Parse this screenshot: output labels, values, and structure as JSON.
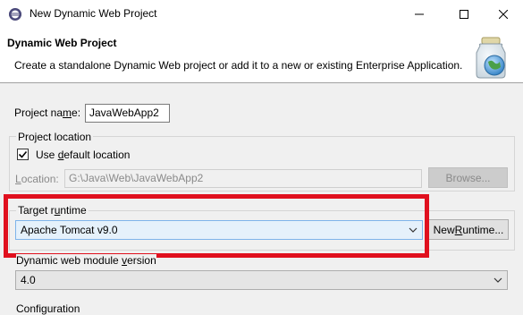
{
  "window": {
    "title": "New Dynamic Web Project"
  },
  "header": {
    "title": "Dynamic Web Project",
    "description": "Create a standalone Dynamic Web project or add it to a new or existing Enterprise Application."
  },
  "project_name": {
    "label_prefix": "Project na",
    "label_mnemonic": "m",
    "label_suffix": "e:",
    "value": "JavaWebApp2"
  },
  "project_location": {
    "group_label": "Project location",
    "use_default": {
      "label_prefix": "Use ",
      "label_mnemonic": "d",
      "label_suffix": "efault location",
      "checked": true
    },
    "location": {
      "label_mnemonic": "L",
      "label_suffix": "ocation:",
      "value": "G:\\Java\\Web\\JavaWebApp2"
    },
    "browse_button": "Browse..."
  },
  "target_runtime": {
    "group_label_prefix": "Target r",
    "group_label_mnemonic": "u",
    "group_label_suffix": "ntime",
    "selected": "Apache Tomcat v9.0",
    "new_runtime": {
      "label_prefix": "New ",
      "label_mnemonic": "R",
      "label_suffix": "untime..."
    }
  },
  "web_module_version": {
    "label_prefix": "Dynamic web module ",
    "label_mnemonic": "v",
    "label_suffix": "ersion",
    "selected": "4.0"
  },
  "configuration": {
    "label": "Configuration"
  },
  "colors": {
    "highlight": "#e0101e",
    "combo_focus_bg": "#e5f1fb",
    "combo_focus_border": "#7eb4ea"
  }
}
